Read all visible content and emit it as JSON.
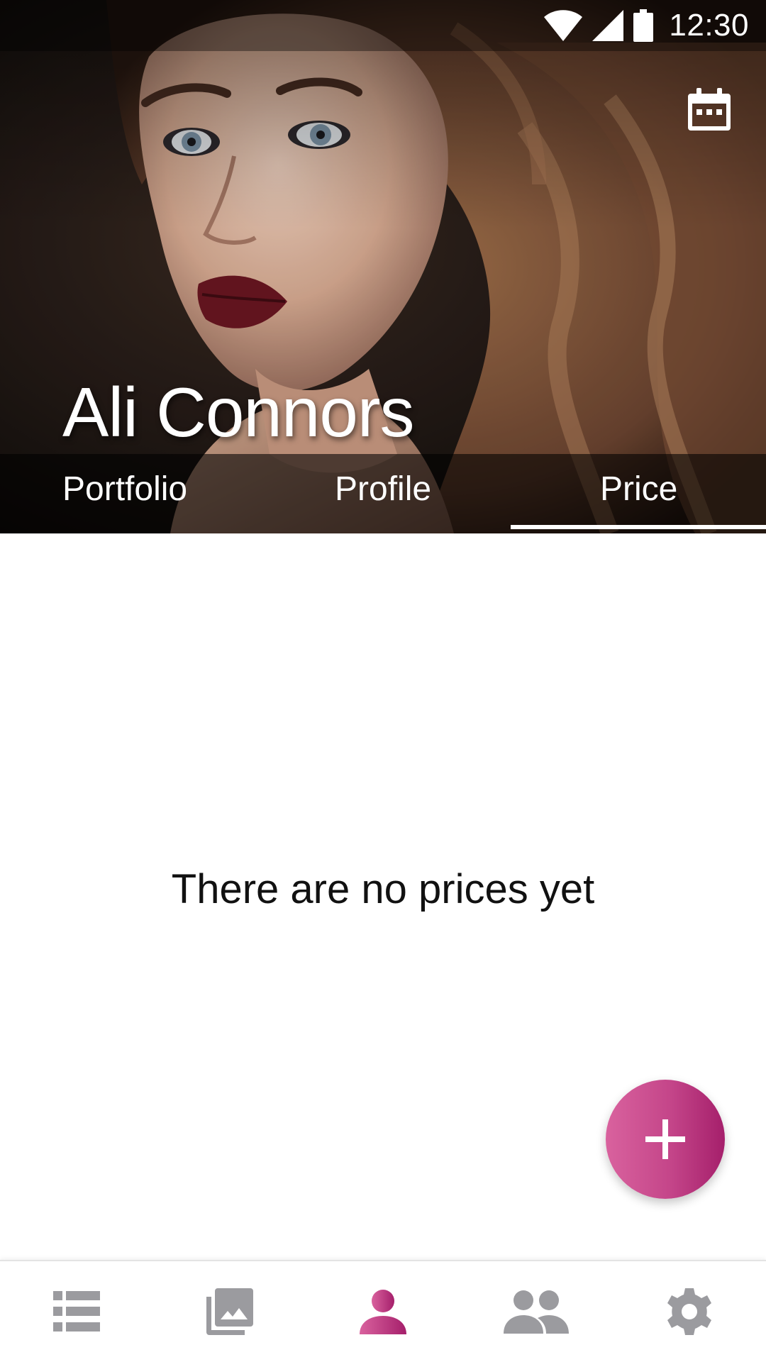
{
  "status_bar": {
    "time": "12:30",
    "icons": [
      "wifi-icon",
      "cell-signal-icon",
      "battery-icon"
    ]
  },
  "toolbar": {
    "action_icon": "calendar-icon"
  },
  "profile": {
    "name": "Ali Connors"
  },
  "tabs": [
    {
      "label": "Portfolio",
      "selected": false
    },
    {
      "label": "Profile",
      "selected": false
    },
    {
      "label": "Price",
      "selected": true
    }
  ],
  "content": {
    "empty_message": "There are no prices yet"
  },
  "fab": {
    "icon": "plus-icon"
  },
  "bottom_nav": {
    "items": [
      {
        "icon": "list-icon",
        "selected": false
      },
      {
        "icon": "photo-library-icon",
        "selected": false
      },
      {
        "icon": "person-icon",
        "selected": true
      },
      {
        "icon": "people-icon",
        "selected": false
      },
      {
        "icon": "settings-icon",
        "selected": false
      }
    ]
  },
  "colors": {
    "accent": "#c44589",
    "accent_light": "#d9629e",
    "accent_dark": "#a51f6b",
    "nav_inactive": "#9b9b9f",
    "text_primary": "#111111",
    "on_dark": "#ffffff"
  }
}
